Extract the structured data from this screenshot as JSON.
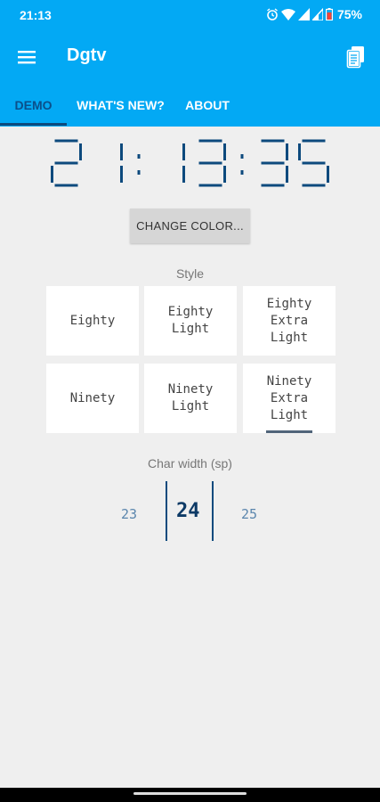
{
  "status_bar": {
    "time": "21:13",
    "battery": "75%",
    "icons": [
      "alarm-icon",
      "wifi-icon",
      "signal-icon",
      "signal-2-icon",
      "battery-icon"
    ]
  },
  "app_bar": {
    "title": "Dgtv",
    "menu_icon": "menu-icon",
    "action_icon": "copy-icon"
  },
  "tabs": [
    {
      "label": "DEMO",
      "active": true
    },
    {
      "label": "WHAT'S NEW?",
      "active": false
    },
    {
      "label": "ABOUT",
      "active": false
    }
  ],
  "clock": {
    "time": "21:13:35"
  },
  "change_color_button": "CHANGE COLOR...",
  "style_section": {
    "label": "Style",
    "options": [
      {
        "label": "Eighty",
        "selected": false
      },
      {
        "label": "Eighty\nLight",
        "selected": false
      },
      {
        "label": "Eighty\nExtra\nLight",
        "selected": false
      },
      {
        "label": "Ninety",
        "selected": false
      },
      {
        "label": "Ninety\nLight",
        "selected": false
      },
      {
        "label": "Ninety\nExtra\nLight",
        "selected": true
      }
    ]
  },
  "char_width": {
    "label": "Char width (sp)",
    "prev": "23",
    "current": "24",
    "next": "25"
  },
  "colors": {
    "primary": "#03a9f4",
    "accent": "#0d4a7d",
    "background": "#efefef"
  }
}
